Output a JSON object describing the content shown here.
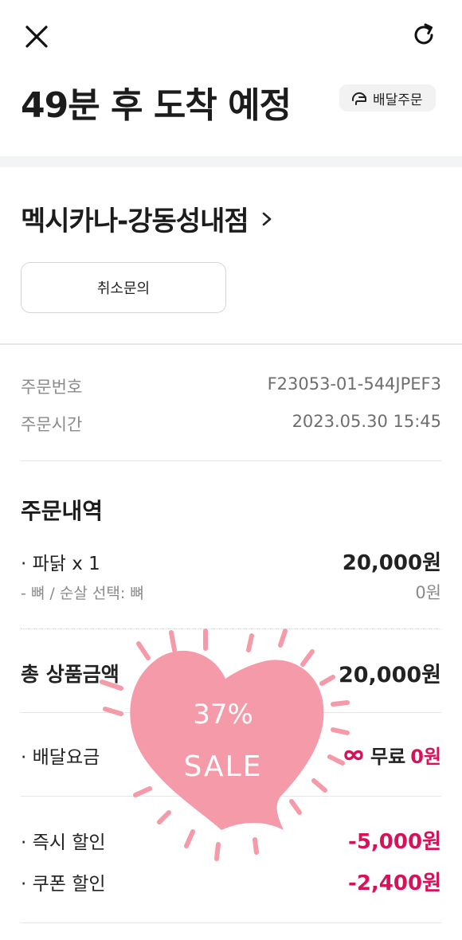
{
  "header": {
    "close_icon": "close-icon",
    "refresh_icon": "refresh-icon",
    "eta_title": "49분 후 도착 예정",
    "delivery_chip_label": "배달주문",
    "delivery_chip_icon": "helmet-icon"
  },
  "store": {
    "name": "멕시카나-강동성내점",
    "chevron_icon": "chevron-right-icon",
    "cancel_button": "취소문의"
  },
  "order_info": {
    "number_label": "주문번호",
    "number_value": "F23053-01-544JPEF3",
    "time_label": "주문시간",
    "time_value": "2023.05.30 15:45"
  },
  "order_details": {
    "title": "주문내역",
    "items": [
      {
        "name": "· 파닭 x 1",
        "price": "20,000원"
      }
    ],
    "options": [
      {
        "name": "- 뼈 / 순살 선택: 뼈",
        "price": "0원"
      }
    ]
  },
  "totals": {
    "subtotal_label": "총 상품금액",
    "subtotal_value": "20,000원",
    "delivery_label": "· 배달요금",
    "delivery_free": "무료",
    "delivery_value": "0원",
    "instant_discount_label": "· 즉시 할인",
    "instant_discount_value": "-5,000원",
    "coupon_discount_label": "· 쿠폰 할인",
    "coupon_discount_value": "-2,400원"
  },
  "sticker": {
    "line1": "37%",
    "line2": "SALE"
  },
  "colors": {
    "accent_pink": "#d6125b",
    "sticker_pink": "#f59aa8"
  }
}
